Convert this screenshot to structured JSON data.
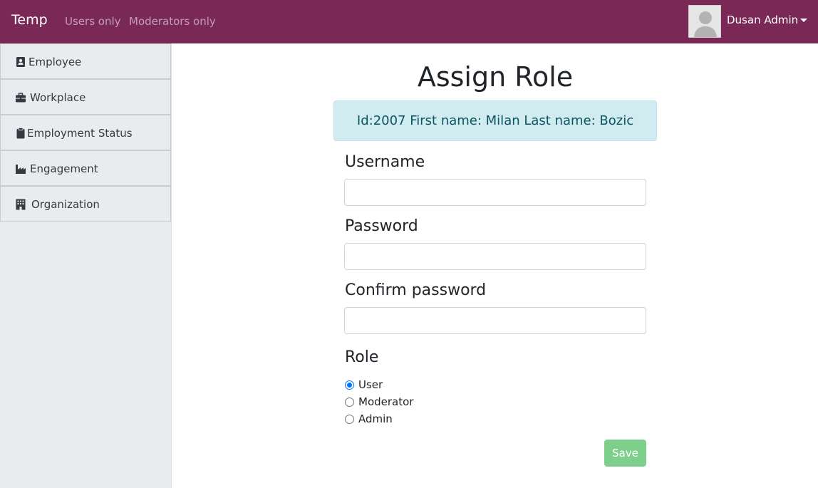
{
  "navbar": {
    "brand": "Temp",
    "links": [
      {
        "label": "Users only"
      },
      {
        "label": "Moderators only"
      }
    ],
    "user": {
      "name": "Dusan Admin"
    },
    "colors": {
      "background": "#7a2855"
    }
  },
  "sidebar": {
    "items": [
      {
        "label": "Employee",
        "icon": "address-card-icon"
      },
      {
        "label": "Workplace",
        "icon": "briefcase-icon"
      },
      {
        "label": "Employment Status",
        "icon": "clipboard-icon"
      },
      {
        "label": "Engagement",
        "icon": "industry-icon"
      },
      {
        "label": "Organization",
        "icon": "building-icon"
      }
    ]
  },
  "main": {
    "title": "Assign Role",
    "info": "Id:2007 First name: Milan Last name: Bozic",
    "fields": {
      "username": {
        "label": "Username",
        "value": ""
      },
      "password": {
        "label": "Password",
        "value": ""
      },
      "confirm": {
        "label": "Confirm password",
        "value": ""
      }
    },
    "role": {
      "label": "Role",
      "options": [
        {
          "label": "User",
          "checked": true
        },
        {
          "label": "Moderator",
          "checked": false
        },
        {
          "label": "Admin",
          "checked": false
        }
      ]
    },
    "save_label": "Save",
    "colors": {
      "save": "#7fcf8c",
      "alert_bg": "#d1ecf1",
      "alert_text": "#0c5460"
    }
  }
}
